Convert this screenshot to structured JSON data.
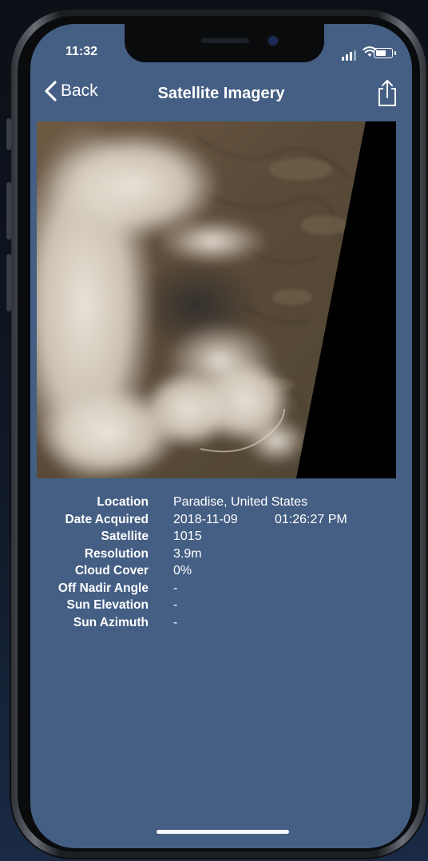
{
  "status": {
    "time": "11:32"
  },
  "nav": {
    "back_label": "Back",
    "title": "Satellite Imagery",
    "share_icon": "share-icon"
  },
  "image": {
    "subject": "satellite-image-wildfire-smoke"
  },
  "details": {
    "location_label": "Location",
    "location_value": "Paradise, United States",
    "date_label": "Date Acquired",
    "date_value": "2018-11-09",
    "time_value": "01:26:27 PM",
    "satellite_label": "Satellite",
    "satellite_value": "1015",
    "resolution_label": "Resolution",
    "resolution_value": "3.9m",
    "cloud_label": "Cloud Cover",
    "cloud_value": "0%",
    "nadir_label": "Off Nadir Angle",
    "nadir_value": "-",
    "elevation_label": "Sun Elevation",
    "elevation_value": "-",
    "azimuth_label": "Sun Azimuth",
    "azimuth_value": "-"
  },
  "colors": {
    "screen_bg": "#445e84",
    "text": "#ffffff"
  }
}
